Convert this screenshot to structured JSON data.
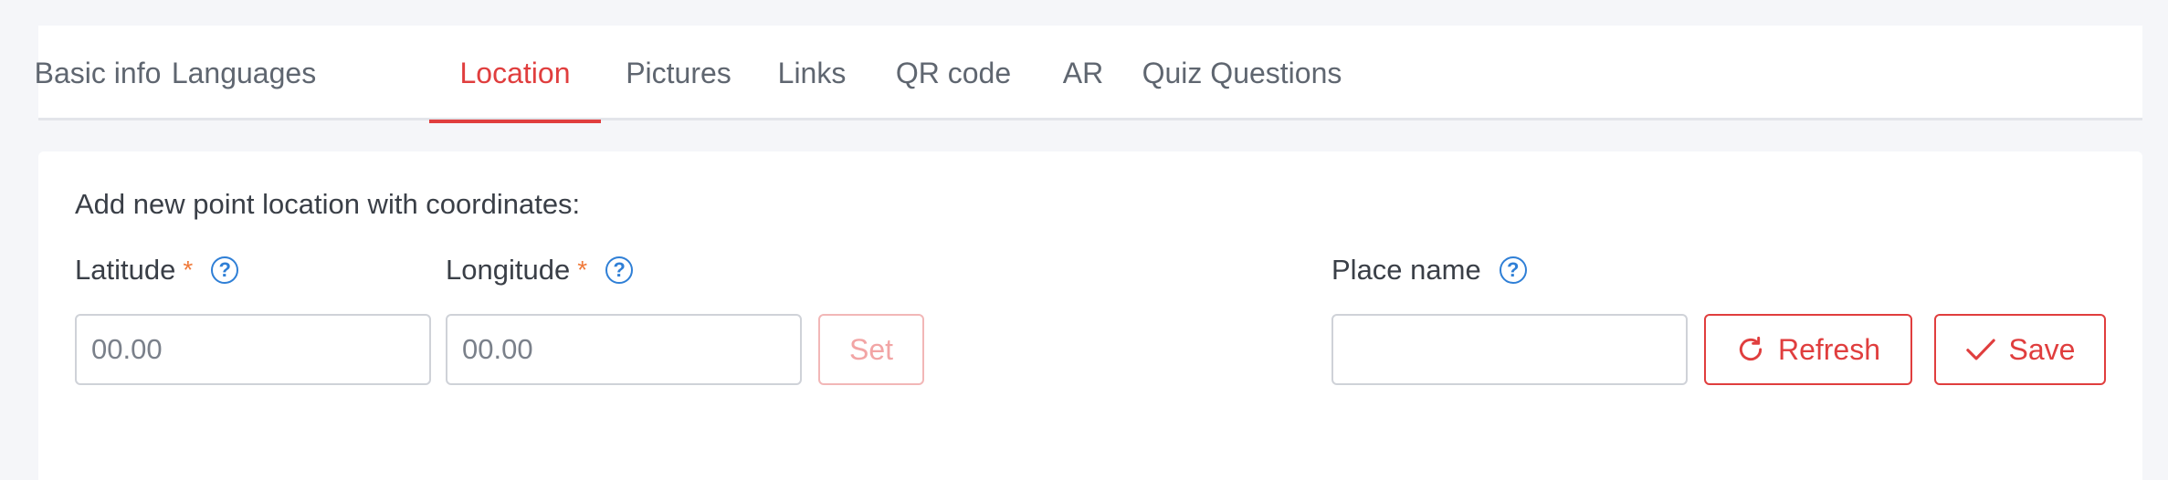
{
  "tabs": [
    {
      "label": "Basic info"
    },
    {
      "label": "Languages"
    },
    {
      "label": "Location",
      "active": true
    },
    {
      "label": "Pictures"
    },
    {
      "label": "Links"
    },
    {
      "label": "QR code"
    },
    {
      "label": "AR"
    },
    {
      "label": "Quiz Questions"
    }
  ],
  "form": {
    "intro": "Add new point location with coordinates:",
    "latitude": {
      "label": "Latitude",
      "required_mark": "*",
      "placeholder": "00.00",
      "value": ""
    },
    "longitude": {
      "label": "Longitude",
      "required_mark": "*",
      "placeholder": "00.00",
      "value": ""
    },
    "set_button": "Set",
    "place_name": {
      "label": "Place name",
      "value": ""
    },
    "refresh_button": "Refresh",
    "save_button": "Save",
    "help_glyph": "?"
  },
  "colors": {
    "accent": "#e03e3e",
    "help": "#2f7fd6",
    "required": "#f07a3a",
    "background": "#f5f6f9"
  },
  "icons": {
    "help": "question-circle-icon",
    "refresh": "refresh-icon",
    "save": "check-icon"
  }
}
